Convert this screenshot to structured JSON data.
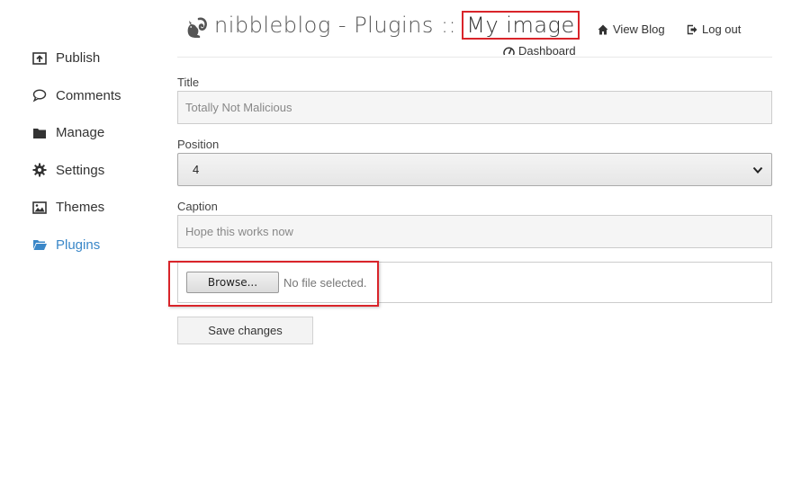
{
  "sidebar": {
    "items": [
      {
        "label": "Publish",
        "icon": "publish-icon",
        "active": false
      },
      {
        "label": "Comments",
        "icon": "comment-icon",
        "active": false
      },
      {
        "label": "Manage",
        "icon": "folder-icon",
        "active": false
      },
      {
        "label": "Settings",
        "icon": "gear-icon",
        "active": false
      },
      {
        "label": "Themes",
        "icon": "image-icon",
        "active": false
      },
      {
        "label": "Plugins",
        "icon": "folder-open-icon",
        "active": true
      }
    ],
    "active_color": "#3a87c8"
  },
  "header": {
    "app_title": "nibbleblog - Plugins ::",
    "plugin_name": "My image",
    "logo_icon": "squirrel-logo-icon",
    "links": {
      "view_blog": "View Blog",
      "log_out": "Log out",
      "dashboard": "Dashboard"
    }
  },
  "form": {
    "title": {
      "label": "Title",
      "value": "Totally Not Malicious"
    },
    "position": {
      "label": "Position",
      "selected": "4"
    },
    "caption": {
      "label": "Caption",
      "value": "Hope this works now"
    },
    "file": {
      "button_label": "Browse...",
      "status": "No file selected."
    },
    "save_label": "Save changes"
  },
  "highlight_color": "#d9242a"
}
